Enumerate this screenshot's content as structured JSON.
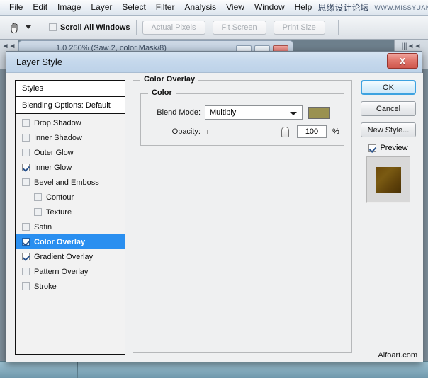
{
  "app": {
    "menus": [
      "File",
      "Edit",
      "Image",
      "Layer",
      "Select",
      "Filter",
      "Analysis",
      "View",
      "Window",
      "Help"
    ],
    "watermark_cn": "思缘设计论坛",
    "watermark_url": "WWW.MISSYUAN.COM",
    "options_bar": {
      "tool_icon": "hand-tool-icon",
      "scroll_all_windows_label": "Scroll All Windows",
      "scroll_all_windows_checked": false,
      "buttons": [
        "Actual Pixels",
        "Fit Screen",
        "Print Size"
      ]
    },
    "document_window_title": "1.0 250% (Saw 2, color Mask/8)",
    "dock_left_icon": "collapse-left-icon",
    "dock_right_icon": "collapse-right-icon"
  },
  "dialog": {
    "title": "Layer Style",
    "close_label": "X",
    "styles_panel": {
      "header": "Styles",
      "blending_options": "Blending Options: Default",
      "items": [
        {
          "label": "Drop Shadow",
          "checked": false,
          "indent": false,
          "selected": false
        },
        {
          "label": "Inner Shadow",
          "checked": false,
          "indent": false,
          "selected": false
        },
        {
          "label": "Outer Glow",
          "checked": false,
          "indent": false,
          "selected": false
        },
        {
          "label": "Inner Glow",
          "checked": true,
          "indent": false,
          "selected": false
        },
        {
          "label": "Bevel and Emboss",
          "checked": false,
          "indent": false,
          "selected": false
        },
        {
          "label": "Contour",
          "checked": false,
          "indent": true,
          "selected": false
        },
        {
          "label": "Texture",
          "checked": false,
          "indent": true,
          "selected": false
        },
        {
          "label": "Satin",
          "checked": false,
          "indent": false,
          "selected": false
        },
        {
          "label": "Color Overlay",
          "checked": true,
          "indent": false,
          "selected": true
        },
        {
          "label": "Gradient Overlay",
          "checked": true,
          "indent": false,
          "selected": false
        },
        {
          "label": "Pattern Overlay",
          "checked": false,
          "indent": false,
          "selected": false
        },
        {
          "label": "Stroke",
          "checked": false,
          "indent": false,
          "selected": false
        }
      ]
    },
    "panel": {
      "group_title": "Color Overlay",
      "subgroup_title": "Color",
      "blend_mode_label": "Blend Mode:",
      "blend_mode_value": "Multiply",
      "overlay_color": "#9a9150",
      "opacity_label": "Opacity:",
      "opacity_value": "100",
      "opacity_unit": "%"
    },
    "buttons": {
      "ok": "OK",
      "cancel": "Cancel",
      "new_style": "New Style...",
      "preview_label": "Preview",
      "preview_checked": true
    },
    "watermark": "Alfoart.com"
  },
  "colors": {
    "selection_blue": "#2a8ff0",
    "overlay_swatch": "#9a9150",
    "close_red": "#d4615a"
  }
}
